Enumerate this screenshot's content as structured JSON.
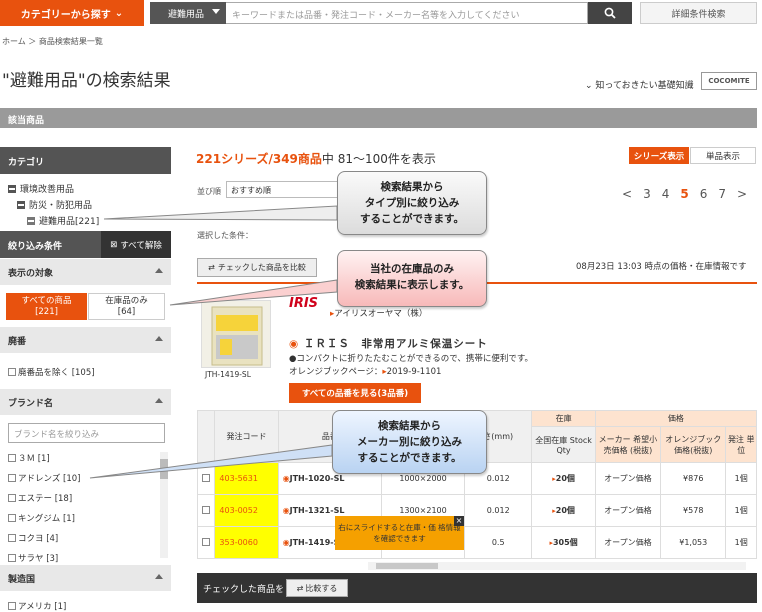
{
  "header": {
    "category_button": "カテゴリーから探す",
    "search_category": "避難用品",
    "search_placeholder": "キーワードまたは品番・発注コード・メーカー名等を入力してください",
    "advanced_search": "詳細条件検索"
  },
  "breadcrumb": "ホーム ＞ 商品検索結果一覧",
  "page_title": "\"避難用品\"の検索結果",
  "know_link": "知っておきたい基礎知識",
  "logo_text": "COCOMITE",
  "section_bar": "該当商品",
  "sidebar": {
    "category_header": "カテゴリ",
    "tree": [
      "環境改善用品",
      "防災・防犯用品",
      "避難用品[221]"
    ],
    "filter_header": "絞り込み条件",
    "clear_all": "すべて解除",
    "display_target": "表示の対象",
    "all_products": "すべての商品",
    "all_count": "[221]",
    "in_stock": "在庫品のみ",
    "stock_count": "[64]",
    "discontinued_header": "廃番",
    "exclude_discontinued": "廃番品を除く [105]",
    "brand_header": "ブランド名",
    "brand_placeholder": "ブランド名を絞り込み",
    "brands": [
      "３Ｍ [1]",
      "アドレンズ [10]",
      "エステー [18]",
      "キングジム [1]",
      "コクヨ [4]",
      "サラヤ [3]"
    ],
    "country_header": "製造国",
    "countries": [
      "アメリカ [1]"
    ]
  },
  "results": {
    "series_count": "221",
    "summary": "シリーズ/349商品",
    "range": "中 81～100件を表示",
    "view_series": "シリーズ表示",
    "view_single": "単品表示",
    "order_label": "並び順",
    "order_value": "おすすめ順",
    "pages": [
      "<",
      "3",
      "4",
      "5",
      "6",
      "7",
      ">"
    ],
    "current_page": "5",
    "selected_conditions": "選択した条件：",
    "compare_button": "チェックした商品を比較",
    "price_note": "08月23日 13:03 時点の価格・在庫情報です"
  },
  "product": {
    "image_code": "JTH-1419-SL",
    "brand_logo": "IRIS",
    "maker": "アイリスオーヤマ（株）",
    "name": "ＩＲＩＳ　非常用アルミ保温シート",
    "desc": "●コンパクトに折りたたむことができるので、携帯に便利です。",
    "orange_book": "オレンジブックページ：",
    "orange_book_page": "2019-9-1101",
    "view_all": "すべての品番を見る(3品番)"
  },
  "table": {
    "group_stock": "在庫",
    "group_price": "価格",
    "headers": [
      "発注コード",
      "品番",
      "",
      "さ(mm)",
      "全国在庫 Stock Qty",
      "メーカー 希望小売価格 (税抜)",
      "オレンジブック 価格(税抜)",
      "発注 単位"
    ],
    "rows": [
      {
        "code": "403-5631",
        "part": "JTH-1020-SL",
        "size": "1000×2000",
        "thick": "0.012",
        "stock": "20個",
        "list": "オープン価格",
        "price": "¥876",
        "unit": "1個"
      },
      {
        "code": "403-0052",
        "part": "JTH-1321-SL",
        "size": "1300×2100",
        "thick": "0.012",
        "stock": "20個",
        "list": "オープン価格",
        "price": "¥578",
        "unit": "1個"
      },
      {
        "code": "353-0060",
        "part": "JTH-1419-SL",
        "size": "",
        "thick": "0.5",
        "stock": "305個",
        "list": "オープン価格",
        "price": "¥1,053",
        "unit": "1個"
      }
    ]
  },
  "slide_tip": "右にスライドすると在庫・価 格情報を確認できます",
  "bottom": {
    "label": "チェックした商品を",
    "compare": "比較する"
  },
  "callouts": {
    "c1": [
      "検索結果から",
      "タイプ別に絞り込み",
      "することができます。"
    ],
    "c2": [
      "当社の在庫品のみ",
      "検索結果に表示します。"
    ],
    "c3": [
      "検索結果から",
      "メーカー別に絞り込み",
      "することができます。"
    ]
  },
  "colors": {
    "accent": "#e8520e",
    "highlight": "#ffff00",
    "sidebar_dark": "#545454"
  }
}
